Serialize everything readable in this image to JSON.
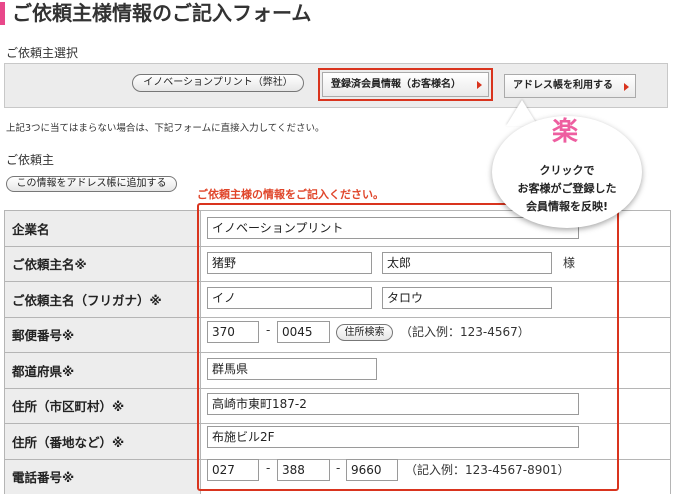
{
  "page_title": "ご依頼主様情報のご記入フォーム",
  "requester_select": {
    "label": "ご依頼主選択",
    "company_button": "イノベーションプリント（弊社）",
    "member_button": "登録済会員情報（お客様名）",
    "address_book_button": "アドレス帳を利用する"
  },
  "note": "上記3つに当てはまらない場合は、下記フォームに直接入力してください。",
  "requester": {
    "label": "ご依頼主",
    "add_to_address_book_button": "この情報をアドレス帳に追加する",
    "prompt": "ご依頼主様の情報をご記入ください。"
  },
  "callout": {
    "icon_char": "楽",
    "line1": "クリックで",
    "line2": "お客様がご登録した",
    "line3": "会員情報を反映!"
  },
  "form": {
    "company": {
      "label": "企業名",
      "value": "イノベーションプリント"
    },
    "name": {
      "label": "ご依頼主名※",
      "last": "猪野",
      "first": "太郎",
      "suffix": "様"
    },
    "kana": {
      "label": "ご依頼主名（フリガナ）※",
      "last": "イノ",
      "first": "タロウ"
    },
    "postal": {
      "label": "郵便番号※",
      "part1": "370",
      "dash": "-",
      "part2": "0045",
      "search_button": "住所検索",
      "example": "（記入例：123-4567）"
    },
    "prefecture": {
      "label": "都道府県※",
      "value": "群馬県"
    },
    "city": {
      "label": "住所（市区町村）※",
      "value": "高崎市東町187-2"
    },
    "street": {
      "label": "住所（番地など）※",
      "value": "布施ビル2F"
    },
    "phone": {
      "label": "電話番号※",
      "part1": "027",
      "part2": "388",
      "part3": "9660",
      "dash": "-",
      "example": "（記入例：123-4567-8901）"
    }
  }
}
